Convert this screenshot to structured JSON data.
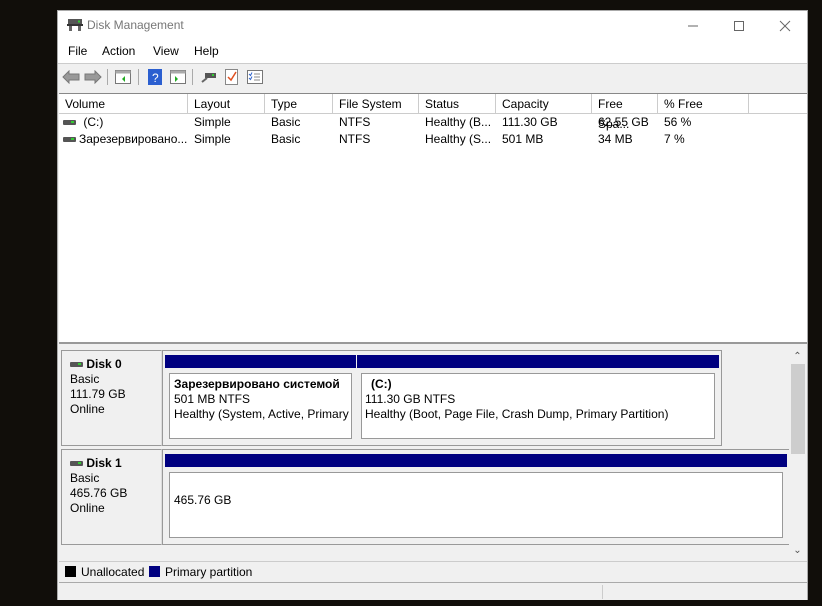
{
  "window": {
    "title": "Disk Management",
    "controls": {
      "minimize": "minimize",
      "maximize": "maximize",
      "close": "close"
    }
  },
  "menu": [
    "File",
    "Action",
    "View",
    "Help"
  ],
  "toolbar": {
    "buttons": [
      {
        "name": "back-icon"
      },
      {
        "name": "forward-icon"
      },
      {
        "name": "show-hide-console-tree-icon"
      },
      {
        "name": "help-icon"
      },
      {
        "name": "show-hide-action-pane-icon"
      },
      {
        "name": "connect-drive-icon"
      },
      {
        "name": "properties-check-icon"
      },
      {
        "name": "list-view-icon"
      }
    ]
  },
  "volume_list": {
    "columns": [
      "Volume",
      "Layout",
      "Type",
      "File System",
      "Status",
      "Capacity",
      "Free Spa...",
      "% Free"
    ],
    "rows": [
      {
        "volume": "(C:)",
        "layout": "Simple",
        "type": "Basic",
        "fs": "NTFS",
        "status": "Healthy (B...",
        "capacity": "111.30 GB",
        "free": "62.55 GB",
        "pct": "56 %"
      },
      {
        "volume": "Зарезервировано...",
        "layout": "Simple",
        "type": "Basic",
        "fs": "NTFS",
        "status": "Healthy (S...",
        "capacity": "501 MB",
        "free": "34 MB",
        "pct": "7 %"
      }
    ]
  },
  "disks": [
    {
      "name": "Disk 0",
      "type": "Basic",
      "size": "111.79 GB",
      "state": "Online",
      "partitions": [
        {
          "name": "Зарезервировано системой",
          "size_fs": "501 MB NTFS",
          "status": "Healthy (System, Active, Primary P"
        },
        {
          "name": "(C:)",
          "size_fs": "111.30 GB NTFS",
          "status": "Healthy (Boot, Page File, Crash Dump, Primary Partition)"
        }
      ]
    },
    {
      "name": "Disk 1",
      "type": "Basic",
      "size": "465.76 GB",
      "state": "Online",
      "partitions": [
        {
          "name": "",
          "size_fs": "465.76 GB",
          "status": ""
        }
      ]
    }
  ],
  "legend": [
    {
      "label": "Unallocated",
      "color": "#000000"
    },
    {
      "label": "Primary partition",
      "color": "#000080"
    }
  ]
}
